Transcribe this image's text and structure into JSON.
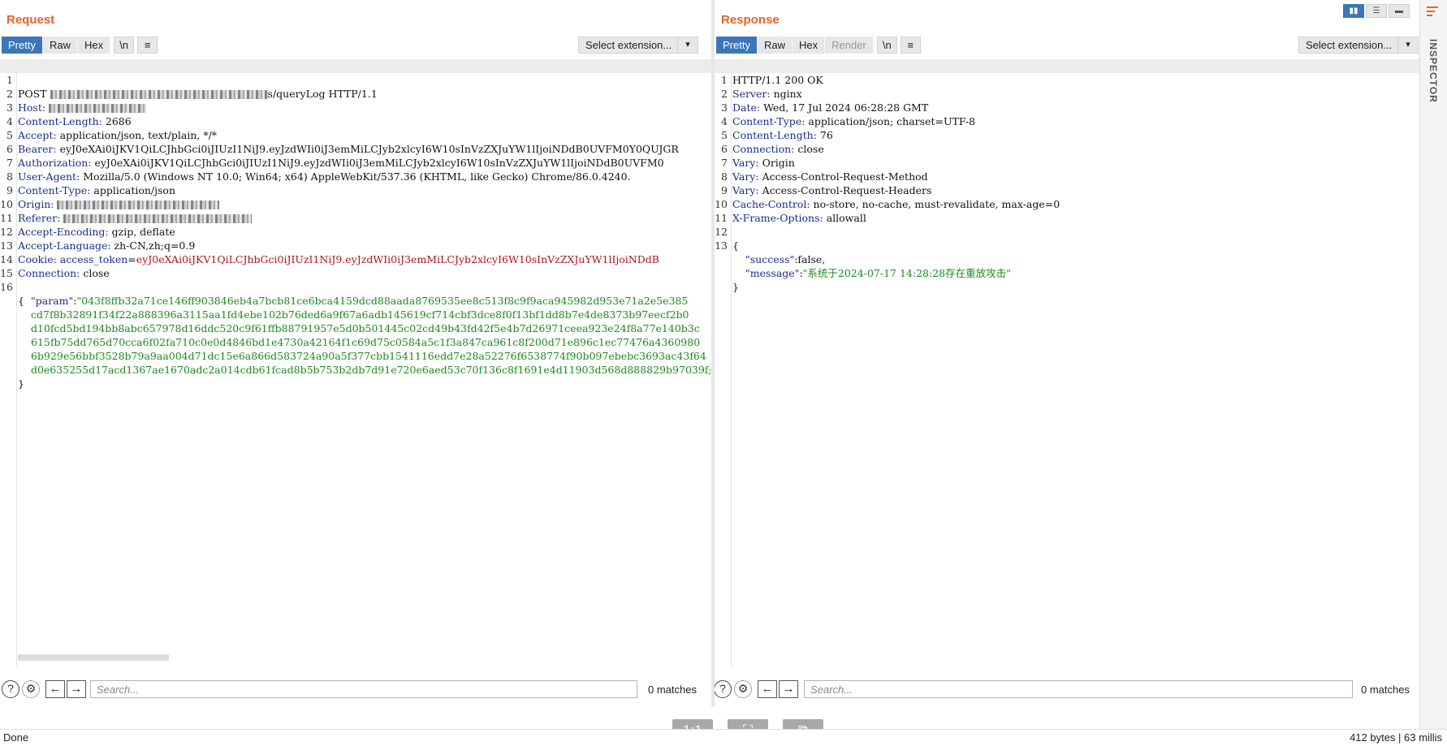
{
  "request": {
    "title": "Request",
    "tabs": [
      {
        "label": "Pretty",
        "active": true
      },
      {
        "label": "Raw",
        "active": false
      },
      {
        "label": "Hex",
        "active": false
      }
    ],
    "newline_label": "\\n",
    "extension_label": "Select extension...",
    "lines": {
      "l1_method": "POST ",
      "l1_rest": "s/queryLog HTTP/1.1",
      "l2_key": "Host:",
      "l3_key": "Content-Length:",
      "l3_val": " 2686",
      "l4_key": "Accept:",
      "l4_val": " application/json, text/plain, */*",
      "l5_key": "Bearer:",
      "l5_val": " eyJ0eXAi0iJKV1QiLCJhbGci0iJIUzI1NiJ9.eyJzdWIi0iJ3emMiLCJyb2xlcyI6W10sInVzZXJuYW1lIjoiNDdB0UVFM0Y0QUJGR",
      "l6_key": "Authorization:",
      "l6_val": " eyJ0eXAi0iJKV1QiLCJhbGci0iJIUzI1NiJ9.eyJzdWIi0iJ3emMiLCJyb2xlcyI6W10sInVzZXJuYW1lIjoiNDdB0UVFM0",
      "l7_key": "User-Agent:",
      "l7_val": " Mozilla/5.0 (Windows NT 10.0; Win64; x64) AppleWebKit/537.36 (KHTML, like Gecko) Chrome/86.0.4240.",
      "l8_key": "Content-Type:",
      "l8_val": " application/json",
      "l9_key": "Origin:",
      "l10_key": "Referer:",
      "l11_key": "Accept-Encoding:",
      "l11_val": " gzip, deflate",
      "l12_key": "Accept-Language:",
      "l12_val": " zh-CN,zh;q=0.9",
      "l13_key": "Cookie:",
      "l13_cookie": " access_token",
      "l13_eq": "=",
      "l13_val": "eyJ0eXAi0iJKV1QiLCJhbGci0iJIUzI1NiJ9.eyJzdWIi0iJ3emMiLCJyb2xlcyI6W10sInVzZXJuYW1lIjoiNDdB",
      "l14_key": "Connection:",
      "l14_val": " close",
      "l16": "{",
      "l17_key": "\"param\"",
      "l17_colon": ":",
      "l17_val": "\"043f8ffb32a71ce146ff903846eb4a7bcb81ce6bca4159dcd88aada8769535ee8c513f8c9f9aca945982d953e71a2e5e385",
      "l18": "cd7f8b32891f34f22a888396a3115aa1fd4ebe102b76ded6a9f67a6adb145619cf714cbf3dce8f0f13bf1dd8b7e4de8373b97eecf2b0",
      "l19": "d10fcd5bd194bb8abc657978d16ddc520c9f61ffb88791957e5d0b501445c02cd49b43fd42f5e4b7d26971ceea923e24f8a77e140b3c",
      "l20": "615fb75dd765d70cca6f02fa710c0e0d4846bd1e4730a42164f1c69d75c0584a5c1f3a847ca961c8f200d71e896c1ec77476a4360980",
      "l21": "6b929e56bbf3528b79a9aa004d71dc15e6a866d583724a90a5f377cbb1541116edd7e28a52276f6538774f90b097ebebc3693ac43f64",
      "l22": "d0e635255d17acd1367ae1670adc2a014cdb61fcad8b5b753b2db7d91e720e6aed53c70f136c8f1691e4d11903d568d888829b97039f;",
      "l23": "}"
    },
    "search_placeholder": "Search...",
    "matches": "0 matches"
  },
  "response": {
    "title": "Response",
    "tabs": [
      {
        "label": "Pretty",
        "active": true
      },
      {
        "label": "Raw",
        "active": false
      },
      {
        "label": "Hex",
        "active": false
      },
      {
        "label": "Render",
        "active": false
      }
    ],
    "newline_label": "\\n",
    "extension_label": "Select extension...",
    "lines": {
      "l1": "HTTP/1.1 200 OK",
      "l2_key": "Server:",
      "l2_val": " nginx",
      "l3_key": "Date:",
      "l3_val": " Wed, 17 Jul 2024 06:28:28 GMT",
      "l4_key": "Content-Type:",
      "l4_val": " application/json; charset=UTF-8",
      "l5_key": "Content-Length:",
      "l5_val": " 76",
      "l6_key": "Connection:",
      "l6_val": " close",
      "l7_key": "Vary:",
      "l7_val": " Origin",
      "l8_key": "Vary:",
      "l8_val": " Access-Control-Request-Method",
      "l9_key": "Vary:",
      "l9_val": " Access-Control-Request-Headers",
      "l10_key": "Cache-Control:",
      "l10_val": " no-store, no-cache, must-revalidate, max-age=0",
      "l11_key": "X-Frame-Options:",
      "l11_val": " allowall",
      "l13": "{",
      "l14_key": "\"success\"",
      "l14_val": ":false,",
      "l15_key": "\"message\"",
      "l15_colon": ":",
      "l15_val": "\"系统于2024-07-17 14:28:28存在重放攻击\"",
      "l16": "}"
    },
    "search_placeholder": "Search...",
    "matches": "0 matches"
  },
  "side": {
    "inspector_label": "INSPECTOR"
  },
  "status": {
    "left": "Done",
    "right": "412 bytes | 63 millis"
  },
  "float_buttons": [
    "1:1"
  ]
}
